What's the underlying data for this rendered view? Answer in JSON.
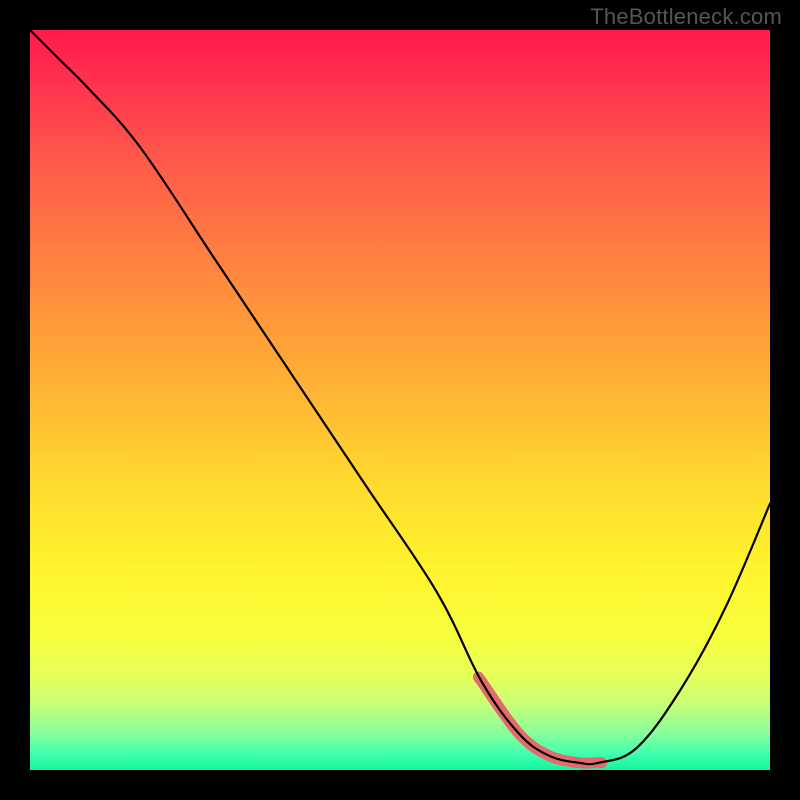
{
  "watermark": "TheBottleneck.com",
  "colors": {
    "background": "#000000",
    "curve": "#000000",
    "highlight_band": "#e56a6a",
    "gradient_top": "#ff1a4a",
    "gradient_bottom": "#16f59e"
  },
  "chart_data": {
    "type": "line",
    "title": "",
    "xlabel": "",
    "ylabel": "",
    "xlim": [
      0,
      100
    ],
    "ylim": [
      0,
      100
    ],
    "series": [
      {
        "name": "bottleneck-curve",
        "x": [
          0,
          4,
          8,
          15,
          25,
          35,
          45,
          55,
          61,
          66,
          70,
          74,
          77,
          82,
          88,
          94,
          100
        ],
        "values": [
          100,
          96,
          92,
          84,
          69,
          54,
          39,
          24,
          12,
          5,
          2,
          1,
          1,
          3,
          11,
          22,
          36
        ]
      }
    ],
    "highlight_band": {
      "x_start": 61,
      "x_end": 77,
      "y": 1
    },
    "annotations": []
  }
}
